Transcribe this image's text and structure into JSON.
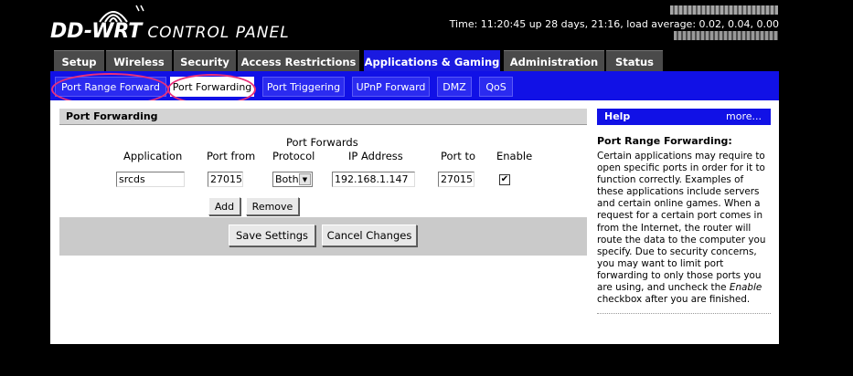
{
  "header": {
    "logo_main": "DD-WRT",
    "logo_sub": "CONTROL PANEL",
    "status_time": "Time: 11:20:45 up 28 days, 21:16, load average: 0.02, 0.04, 0.00"
  },
  "top_tabs": [
    "Setup",
    "Wireless",
    "Security",
    "Access Restrictions",
    "Applications & Gaming",
    "Administration",
    "Status"
  ],
  "top_tabs_active": "Applications & Gaming",
  "sub_tabs": [
    "Port Range Forward",
    "Port Forwarding",
    "Port Triggering",
    "UPnP Forward",
    "DMZ",
    "QoS"
  ],
  "sub_tabs_active": "Port Forwarding",
  "section_title": "Port Forwarding",
  "form": {
    "group_label": "Port Forwards",
    "columns": [
      "Application",
      "Port from",
      "Protocol",
      "IP Address",
      "Port to",
      "Enable"
    ],
    "rows": [
      {
        "application": "srcds",
        "port_from": "27015",
        "protocol": "Both",
        "ip_address": "192.168.1.147",
        "port_to": "27015",
        "enable_mark": "✔"
      }
    ],
    "add_label": "Add",
    "remove_label": "Remove",
    "save_label": "Save Settings",
    "cancel_label": "Cancel Changes"
  },
  "help": {
    "title": "Help",
    "more": "more...",
    "subtitle": "Port Range Forwarding:",
    "body_before": "Certain applications may require to open specific ports in order for it to function correctly. Examples of these applications include servers and certain online games. When a request for a certain port comes in from the Internet, the router will route the data to the computer you specify. Due to security concerns, you may want to limit port forwarding to only those ports you are using, and uncheck the ",
    "body_em": "Enable",
    "body_after": " checkbox after you are finished."
  },
  "colors": {
    "accent_blue": "#1111e6",
    "tab_gray": "#4a4a4a",
    "highlight_circle": "#e8307a"
  }
}
